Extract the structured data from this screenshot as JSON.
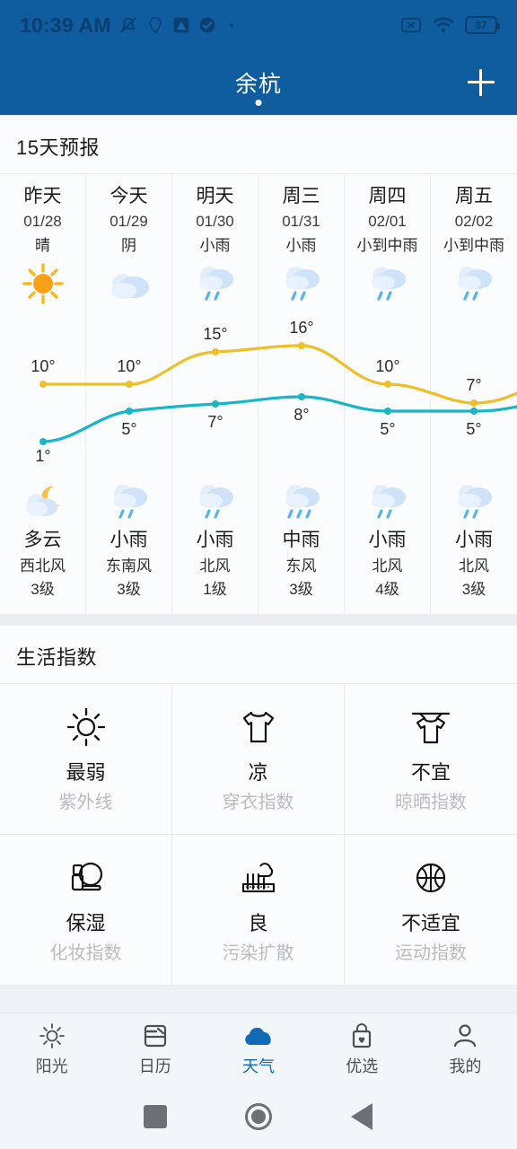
{
  "statusbar": {
    "time": "10:39 AM",
    "left_icons": [
      "mute-icon",
      "location-icon",
      "app-icon",
      "check-circle-icon",
      "dot-icon"
    ],
    "right_icons": [
      "no-sim-icon",
      "wifi-icon"
    ],
    "battery_level": "87"
  },
  "appbar": {
    "title": "余杭",
    "add_label": "+",
    "brand_color": "#0f5c9e"
  },
  "forecast": {
    "section_title": "15天预报",
    "days": [
      {
        "day": "昨天",
        "date": "01/28",
        "cond": "晴",
        "icon": "sun-icon",
        "night_cond": "多云",
        "night_icon": "moon-cloud-icon",
        "wind_dir": "西北风",
        "wind_level": "3级",
        "high": "10°",
        "low": "1°"
      },
      {
        "day": "今天",
        "date": "01/29",
        "cond": "阴",
        "icon": "cloud-icon",
        "night_cond": "小雨",
        "night_icon": "rain-light-icon",
        "wind_dir": "东南风",
        "wind_level": "3级",
        "high": "10°",
        "low": "5°"
      },
      {
        "day": "明天",
        "date": "01/30",
        "cond": "小雨",
        "icon": "rain-light-icon",
        "night_cond": "小雨",
        "night_icon": "rain-light-icon",
        "wind_dir": "北风",
        "wind_level": "1级",
        "high": "15°",
        "low": "7°"
      },
      {
        "day": "周三",
        "date": "01/31",
        "cond": "小雨",
        "icon": "rain-light-icon",
        "night_cond": "中雨",
        "night_icon": "rain-mid-icon",
        "wind_dir": "东风",
        "wind_level": "3级",
        "high": "16°",
        "low": "8°"
      },
      {
        "day": "周四",
        "date": "02/01",
        "cond": "小到中雨",
        "icon": "rain-light-icon",
        "night_cond": "小雨",
        "night_icon": "rain-light-icon",
        "wind_dir": "北风",
        "wind_level": "4级",
        "high": "10°",
        "low": "5°"
      },
      {
        "day": "周五",
        "date": "02/02",
        "cond": "小到中雨",
        "icon": "rain-light-icon",
        "night_cond": "小雨",
        "night_icon": "rain-light-icon",
        "wind_dir": "北风",
        "wind_level": "3级",
        "high": "7°",
        "low": "5°"
      }
    ]
  },
  "chart_data": {
    "type": "line",
    "title": "15天预报",
    "categories": [
      "01/28",
      "01/29",
      "01/30",
      "01/31",
      "02/01",
      "02/02"
    ],
    "series": [
      {
        "name": "high",
        "color": "#edc028",
        "values": [
          10,
          10,
          15,
          16,
          10,
          7
        ],
        "labels": [
          "10°",
          "10°",
          "15°",
          "16°",
          "10°",
          "7°"
        ]
      },
      {
        "name": "low",
        "color": "#18b6c4",
        "values": [
          1,
          5,
          7,
          8,
          5,
          5
        ],
        "labels": [
          "1°",
          "5°",
          "7°",
          "8°",
          "5°",
          "5°"
        ]
      }
    ],
    "xlabel": "",
    "ylabel": "",
    "ylim": [
      0,
      18
    ],
    "grid": true,
    "legend": "none"
  },
  "life_index": {
    "section_title": "生活指数",
    "items": [
      {
        "value": "最弱",
        "name": "紫外线",
        "icon": "sun-outline-icon"
      },
      {
        "value": "凉",
        "name": "穿衣指数",
        "icon": "tshirt-icon"
      },
      {
        "value": "不宜",
        "name": "晾晒指数",
        "icon": "hanging-shirt-icon"
      },
      {
        "value": "保湿",
        "name": "化妆指数",
        "icon": "cosmetics-icon"
      },
      {
        "value": "良",
        "name": "污染扩散",
        "icon": "factory-icon"
      },
      {
        "value": "不适宜",
        "name": "运动指数",
        "icon": "basketball-icon"
      }
    ]
  },
  "bottom_nav": {
    "active_index": 2,
    "active_color": "#0f6bb5",
    "items": [
      {
        "label": "阳光",
        "icon": "sun-outline-icon"
      },
      {
        "label": "日历",
        "icon": "calendar-icon"
      },
      {
        "label": "天气",
        "icon": "cloud-filled-icon"
      },
      {
        "label": "优选",
        "icon": "shopping-bag-heart-icon"
      },
      {
        "label": "我的",
        "icon": "person-icon"
      }
    ]
  },
  "system_nav": {
    "recents": "recents-square-icon",
    "home": "home-circle-icon",
    "back": "back-triangle-icon"
  }
}
